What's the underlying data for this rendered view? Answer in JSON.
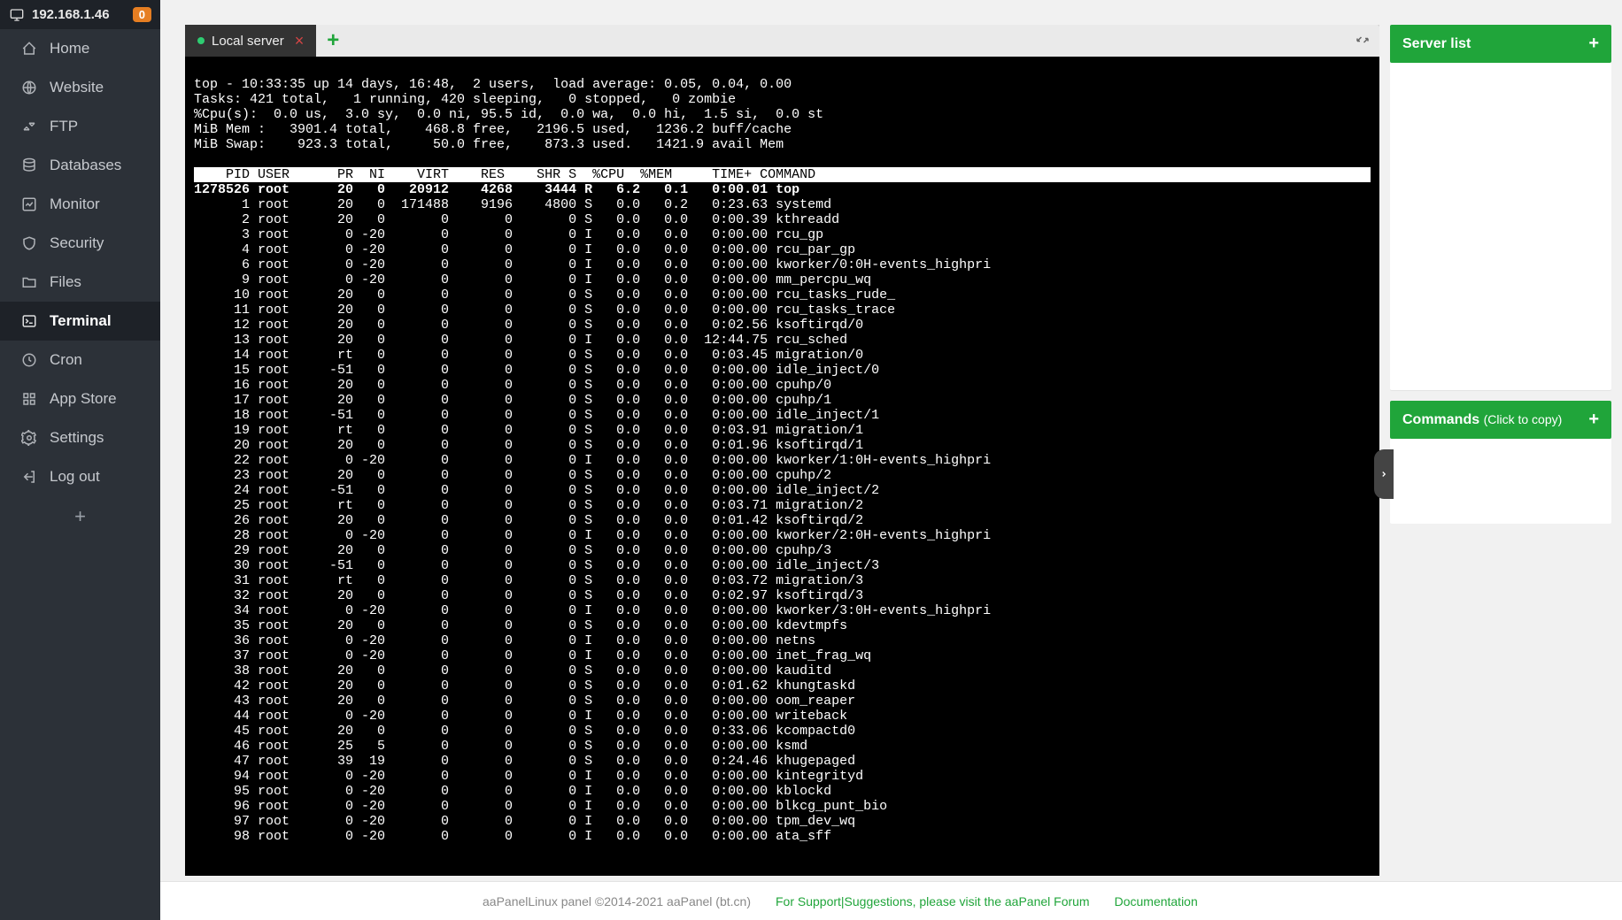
{
  "header": {
    "ip": "192.168.1.46",
    "alert_count": "0"
  },
  "nav": [
    {
      "key": "home",
      "label": "Home"
    },
    {
      "key": "website",
      "label": "Website"
    },
    {
      "key": "ftp",
      "label": "FTP"
    },
    {
      "key": "databases",
      "label": "Databases"
    },
    {
      "key": "monitor",
      "label": "Monitor"
    },
    {
      "key": "security",
      "label": "Security"
    },
    {
      "key": "files",
      "label": "Files"
    },
    {
      "key": "terminal",
      "label": "Terminal",
      "active": true
    },
    {
      "key": "cron",
      "label": "Cron"
    },
    {
      "key": "appstore",
      "label": "App Store"
    },
    {
      "key": "settings",
      "label": "Settings"
    },
    {
      "key": "logout",
      "label": "Log out"
    }
  ],
  "tabs": {
    "active_label": "Local server"
  },
  "right": {
    "server_list": "Server list",
    "commands": "Commands",
    "commands_hint": "(Click to copy)"
  },
  "footer": {
    "copyright": "aaPanelLinux panel ©2014-2021 aaPanel (bt.cn)",
    "link1": "For Support|Suggestions, please visit the aaPanel Forum",
    "link2": "Documentation"
  },
  "top": {
    "line1": "top - 10:33:35 up 14 days, 16:48,  2 users,  load average: 0.05, 0.04, 0.00",
    "line2": "Tasks: 421 total,   1 running, 420 sleeping,   0 stopped,   0 zombie",
    "line3": "%Cpu(s):  0.0 us,  3.0 sy,  0.0 ni, 95.5 id,  0.0 wa,  0.0 hi,  1.5 si,  0.0 st",
    "line4": "MiB Mem :   3901.4 total,    468.8 free,   2196.5 used,   1236.2 buff/cache",
    "line5": "MiB Swap:    923.3 total,     50.0 free,    873.3 used.   1421.9 avail Mem",
    "header_cols": "    PID USER      PR  NI    VIRT    RES    SHR S  %CPU  %MEM     TIME+ COMMAND",
    "procs": [
      {
        "pid": "1278526",
        "user": "root",
        "pr": "20",
        "ni": "0",
        "virt": "20912",
        "res": "4268",
        "shr": "3444",
        "s": "R",
        "cpu": "6.2",
        "mem": "0.1",
        "time": "0:00.01",
        "cmd": "top",
        "hi": true
      },
      {
        "pid": "1",
        "user": "root",
        "pr": "20",
        "ni": "0",
        "virt": "171488",
        "res": "9196",
        "shr": "4800",
        "s": "S",
        "cpu": "0.0",
        "mem": "0.2",
        "time": "0:23.63",
        "cmd": "systemd"
      },
      {
        "pid": "2",
        "user": "root",
        "pr": "20",
        "ni": "0",
        "virt": "0",
        "res": "0",
        "shr": "0",
        "s": "S",
        "cpu": "0.0",
        "mem": "0.0",
        "time": "0:00.39",
        "cmd": "kthreadd"
      },
      {
        "pid": "3",
        "user": "root",
        "pr": "0",
        "ni": "-20",
        "virt": "0",
        "res": "0",
        "shr": "0",
        "s": "I",
        "cpu": "0.0",
        "mem": "0.0",
        "time": "0:00.00",
        "cmd": "rcu_gp"
      },
      {
        "pid": "4",
        "user": "root",
        "pr": "0",
        "ni": "-20",
        "virt": "0",
        "res": "0",
        "shr": "0",
        "s": "I",
        "cpu": "0.0",
        "mem": "0.0",
        "time": "0:00.00",
        "cmd": "rcu_par_gp"
      },
      {
        "pid": "6",
        "user": "root",
        "pr": "0",
        "ni": "-20",
        "virt": "0",
        "res": "0",
        "shr": "0",
        "s": "I",
        "cpu": "0.0",
        "mem": "0.0",
        "time": "0:00.00",
        "cmd": "kworker/0:0H-events_highpri"
      },
      {
        "pid": "9",
        "user": "root",
        "pr": "0",
        "ni": "-20",
        "virt": "0",
        "res": "0",
        "shr": "0",
        "s": "I",
        "cpu": "0.0",
        "mem": "0.0",
        "time": "0:00.00",
        "cmd": "mm_percpu_wq"
      },
      {
        "pid": "10",
        "user": "root",
        "pr": "20",
        "ni": "0",
        "virt": "0",
        "res": "0",
        "shr": "0",
        "s": "S",
        "cpu": "0.0",
        "mem": "0.0",
        "time": "0:00.00",
        "cmd": "rcu_tasks_rude_"
      },
      {
        "pid": "11",
        "user": "root",
        "pr": "20",
        "ni": "0",
        "virt": "0",
        "res": "0",
        "shr": "0",
        "s": "S",
        "cpu": "0.0",
        "mem": "0.0",
        "time": "0:00.00",
        "cmd": "rcu_tasks_trace"
      },
      {
        "pid": "12",
        "user": "root",
        "pr": "20",
        "ni": "0",
        "virt": "0",
        "res": "0",
        "shr": "0",
        "s": "S",
        "cpu": "0.0",
        "mem": "0.0",
        "time": "0:02.56",
        "cmd": "ksoftirqd/0"
      },
      {
        "pid": "13",
        "user": "root",
        "pr": "20",
        "ni": "0",
        "virt": "0",
        "res": "0",
        "shr": "0",
        "s": "I",
        "cpu": "0.0",
        "mem": "0.0",
        "time": "12:44.75",
        "cmd": "rcu_sched"
      },
      {
        "pid": "14",
        "user": "root",
        "pr": "rt",
        "ni": "0",
        "virt": "0",
        "res": "0",
        "shr": "0",
        "s": "S",
        "cpu": "0.0",
        "mem": "0.0",
        "time": "0:03.45",
        "cmd": "migration/0"
      },
      {
        "pid": "15",
        "user": "root",
        "pr": "-51",
        "ni": "0",
        "virt": "0",
        "res": "0",
        "shr": "0",
        "s": "S",
        "cpu": "0.0",
        "mem": "0.0",
        "time": "0:00.00",
        "cmd": "idle_inject/0"
      },
      {
        "pid": "16",
        "user": "root",
        "pr": "20",
        "ni": "0",
        "virt": "0",
        "res": "0",
        "shr": "0",
        "s": "S",
        "cpu": "0.0",
        "mem": "0.0",
        "time": "0:00.00",
        "cmd": "cpuhp/0"
      },
      {
        "pid": "17",
        "user": "root",
        "pr": "20",
        "ni": "0",
        "virt": "0",
        "res": "0",
        "shr": "0",
        "s": "S",
        "cpu": "0.0",
        "mem": "0.0",
        "time": "0:00.00",
        "cmd": "cpuhp/1"
      },
      {
        "pid": "18",
        "user": "root",
        "pr": "-51",
        "ni": "0",
        "virt": "0",
        "res": "0",
        "shr": "0",
        "s": "S",
        "cpu": "0.0",
        "mem": "0.0",
        "time": "0:00.00",
        "cmd": "idle_inject/1"
      },
      {
        "pid": "19",
        "user": "root",
        "pr": "rt",
        "ni": "0",
        "virt": "0",
        "res": "0",
        "shr": "0",
        "s": "S",
        "cpu": "0.0",
        "mem": "0.0",
        "time": "0:03.91",
        "cmd": "migration/1"
      },
      {
        "pid": "20",
        "user": "root",
        "pr": "20",
        "ni": "0",
        "virt": "0",
        "res": "0",
        "shr": "0",
        "s": "S",
        "cpu": "0.0",
        "mem": "0.0",
        "time": "0:01.96",
        "cmd": "ksoftirqd/1"
      },
      {
        "pid": "22",
        "user": "root",
        "pr": "0",
        "ni": "-20",
        "virt": "0",
        "res": "0",
        "shr": "0",
        "s": "I",
        "cpu": "0.0",
        "mem": "0.0",
        "time": "0:00.00",
        "cmd": "kworker/1:0H-events_highpri"
      },
      {
        "pid": "23",
        "user": "root",
        "pr": "20",
        "ni": "0",
        "virt": "0",
        "res": "0",
        "shr": "0",
        "s": "S",
        "cpu": "0.0",
        "mem": "0.0",
        "time": "0:00.00",
        "cmd": "cpuhp/2"
      },
      {
        "pid": "24",
        "user": "root",
        "pr": "-51",
        "ni": "0",
        "virt": "0",
        "res": "0",
        "shr": "0",
        "s": "S",
        "cpu": "0.0",
        "mem": "0.0",
        "time": "0:00.00",
        "cmd": "idle_inject/2"
      },
      {
        "pid": "25",
        "user": "root",
        "pr": "rt",
        "ni": "0",
        "virt": "0",
        "res": "0",
        "shr": "0",
        "s": "S",
        "cpu": "0.0",
        "mem": "0.0",
        "time": "0:03.71",
        "cmd": "migration/2"
      },
      {
        "pid": "26",
        "user": "root",
        "pr": "20",
        "ni": "0",
        "virt": "0",
        "res": "0",
        "shr": "0",
        "s": "S",
        "cpu": "0.0",
        "mem": "0.0",
        "time": "0:01.42",
        "cmd": "ksoftirqd/2"
      },
      {
        "pid": "28",
        "user": "root",
        "pr": "0",
        "ni": "-20",
        "virt": "0",
        "res": "0",
        "shr": "0",
        "s": "I",
        "cpu": "0.0",
        "mem": "0.0",
        "time": "0:00.00",
        "cmd": "kworker/2:0H-events_highpri"
      },
      {
        "pid": "29",
        "user": "root",
        "pr": "20",
        "ni": "0",
        "virt": "0",
        "res": "0",
        "shr": "0",
        "s": "S",
        "cpu": "0.0",
        "mem": "0.0",
        "time": "0:00.00",
        "cmd": "cpuhp/3"
      },
      {
        "pid": "30",
        "user": "root",
        "pr": "-51",
        "ni": "0",
        "virt": "0",
        "res": "0",
        "shr": "0",
        "s": "S",
        "cpu": "0.0",
        "mem": "0.0",
        "time": "0:00.00",
        "cmd": "idle_inject/3"
      },
      {
        "pid": "31",
        "user": "root",
        "pr": "rt",
        "ni": "0",
        "virt": "0",
        "res": "0",
        "shr": "0",
        "s": "S",
        "cpu": "0.0",
        "mem": "0.0",
        "time": "0:03.72",
        "cmd": "migration/3"
      },
      {
        "pid": "32",
        "user": "root",
        "pr": "20",
        "ni": "0",
        "virt": "0",
        "res": "0",
        "shr": "0",
        "s": "S",
        "cpu": "0.0",
        "mem": "0.0",
        "time": "0:02.97",
        "cmd": "ksoftirqd/3"
      },
      {
        "pid": "34",
        "user": "root",
        "pr": "0",
        "ni": "-20",
        "virt": "0",
        "res": "0",
        "shr": "0",
        "s": "I",
        "cpu": "0.0",
        "mem": "0.0",
        "time": "0:00.00",
        "cmd": "kworker/3:0H-events_highpri"
      },
      {
        "pid": "35",
        "user": "root",
        "pr": "20",
        "ni": "0",
        "virt": "0",
        "res": "0",
        "shr": "0",
        "s": "S",
        "cpu": "0.0",
        "mem": "0.0",
        "time": "0:00.00",
        "cmd": "kdevtmpfs"
      },
      {
        "pid": "36",
        "user": "root",
        "pr": "0",
        "ni": "-20",
        "virt": "0",
        "res": "0",
        "shr": "0",
        "s": "I",
        "cpu": "0.0",
        "mem": "0.0",
        "time": "0:00.00",
        "cmd": "netns"
      },
      {
        "pid": "37",
        "user": "root",
        "pr": "0",
        "ni": "-20",
        "virt": "0",
        "res": "0",
        "shr": "0",
        "s": "I",
        "cpu": "0.0",
        "mem": "0.0",
        "time": "0:00.00",
        "cmd": "inet_frag_wq"
      },
      {
        "pid": "38",
        "user": "root",
        "pr": "20",
        "ni": "0",
        "virt": "0",
        "res": "0",
        "shr": "0",
        "s": "S",
        "cpu": "0.0",
        "mem": "0.0",
        "time": "0:00.00",
        "cmd": "kauditd"
      },
      {
        "pid": "42",
        "user": "root",
        "pr": "20",
        "ni": "0",
        "virt": "0",
        "res": "0",
        "shr": "0",
        "s": "S",
        "cpu": "0.0",
        "mem": "0.0",
        "time": "0:01.62",
        "cmd": "khungtaskd"
      },
      {
        "pid": "43",
        "user": "root",
        "pr": "20",
        "ni": "0",
        "virt": "0",
        "res": "0",
        "shr": "0",
        "s": "S",
        "cpu": "0.0",
        "mem": "0.0",
        "time": "0:00.00",
        "cmd": "oom_reaper"
      },
      {
        "pid": "44",
        "user": "root",
        "pr": "0",
        "ni": "-20",
        "virt": "0",
        "res": "0",
        "shr": "0",
        "s": "I",
        "cpu": "0.0",
        "mem": "0.0",
        "time": "0:00.00",
        "cmd": "writeback"
      },
      {
        "pid": "45",
        "user": "root",
        "pr": "20",
        "ni": "0",
        "virt": "0",
        "res": "0",
        "shr": "0",
        "s": "S",
        "cpu": "0.0",
        "mem": "0.0",
        "time": "0:33.06",
        "cmd": "kcompactd0"
      },
      {
        "pid": "46",
        "user": "root",
        "pr": "25",
        "ni": "5",
        "virt": "0",
        "res": "0",
        "shr": "0",
        "s": "S",
        "cpu": "0.0",
        "mem": "0.0",
        "time": "0:00.00",
        "cmd": "ksmd"
      },
      {
        "pid": "47",
        "user": "root",
        "pr": "39",
        "ni": "19",
        "virt": "0",
        "res": "0",
        "shr": "0",
        "s": "S",
        "cpu": "0.0",
        "mem": "0.0",
        "time": "0:24.46",
        "cmd": "khugepaged"
      },
      {
        "pid": "94",
        "user": "root",
        "pr": "0",
        "ni": "-20",
        "virt": "0",
        "res": "0",
        "shr": "0",
        "s": "I",
        "cpu": "0.0",
        "mem": "0.0",
        "time": "0:00.00",
        "cmd": "kintegrityd"
      },
      {
        "pid": "95",
        "user": "root",
        "pr": "0",
        "ni": "-20",
        "virt": "0",
        "res": "0",
        "shr": "0",
        "s": "I",
        "cpu": "0.0",
        "mem": "0.0",
        "time": "0:00.00",
        "cmd": "kblockd"
      },
      {
        "pid": "96",
        "user": "root",
        "pr": "0",
        "ni": "-20",
        "virt": "0",
        "res": "0",
        "shr": "0",
        "s": "I",
        "cpu": "0.0",
        "mem": "0.0",
        "time": "0:00.00",
        "cmd": "blkcg_punt_bio"
      },
      {
        "pid": "97",
        "user": "root",
        "pr": "0",
        "ni": "-20",
        "virt": "0",
        "res": "0",
        "shr": "0",
        "s": "I",
        "cpu": "0.0",
        "mem": "0.0",
        "time": "0:00.00",
        "cmd": "tpm_dev_wq"
      },
      {
        "pid": "98",
        "user": "root",
        "pr": "0",
        "ni": "-20",
        "virt": "0",
        "res": "0",
        "shr": "0",
        "s": "I",
        "cpu": "0.0",
        "mem": "0.0",
        "time": "0:00.00",
        "cmd": "ata_sff"
      }
    ]
  },
  "icons": {
    "home": "home",
    "website": "globe",
    "ftp": "ftp",
    "databases": "database",
    "monitor": "chart",
    "security": "shield",
    "files": "folder",
    "terminal": "terminal",
    "cron": "clock",
    "appstore": "grid",
    "settings": "gear",
    "logout": "logout"
  }
}
